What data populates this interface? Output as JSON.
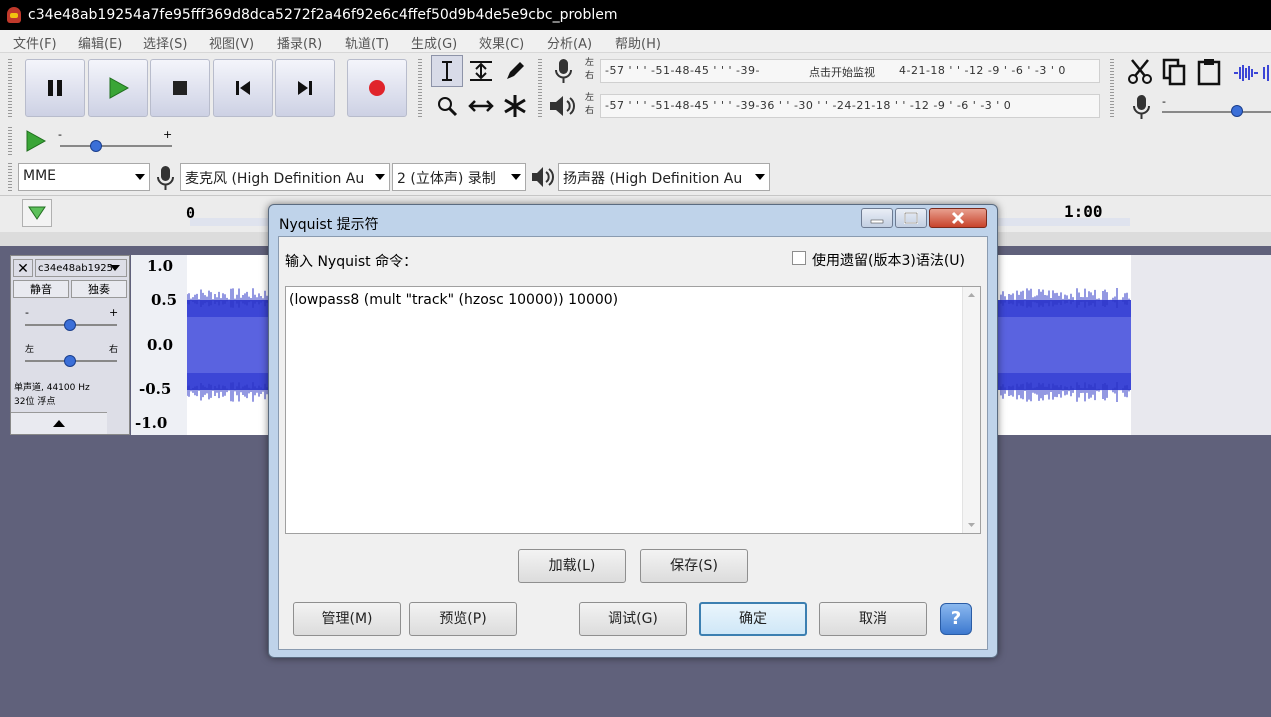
{
  "window": {
    "title": "c34e48ab19254a7fe95fff369d8dca5272f2a46f92e6c4ffef50d9b4de5e9cbc_problem"
  },
  "menu": [
    "文件(F)",
    "编辑(E)",
    "选择(S)",
    "视图(V)",
    "播录(R)",
    "轨道(T)",
    "生成(G)",
    "效果(C)",
    "分析(A)",
    "帮助(H)"
  ],
  "meters": {
    "record_left": "左",
    "record_right": "右",
    "record_ticks": "-57 ' ' ' -51-48-45 ' ' ' -39-",
    "record_prompt": "点击开始监视",
    "record_ticks2": "4-21-18 ' ' -12 -9 ' -6 ' -3 ' 0",
    "play_left": "左",
    "play_right": "右",
    "play_ticks": "-57 ' ' ' -51-48-45 ' ' ' -39-36 ' ' -30 ' ' -24-21-18 ' ' -12 -9 ' -6 ' -3 ' 0"
  },
  "device": {
    "host": "MME",
    "mic": "麦克风 (High Definition Au",
    "channels": "2 (立体声) 录制",
    "speaker": "扬声器 (High Definition Au"
  },
  "timeline": {
    "start": "0",
    "end": "1:00"
  },
  "slider_signs": {
    "minus": "-",
    "plus": "+"
  },
  "track": {
    "name": "c34e48ab1925",
    "mute": "静音",
    "solo": "独奏",
    "gain_minus": "-",
    "gain_plus": "+",
    "pan_left": "左",
    "pan_right": "右",
    "info1": "单声道, 44100 Hz",
    "info2": "32位 浮点",
    "scale": [
      "1.0",
      "0.5",
      "0.0",
      "-0.5",
      "-1.0"
    ]
  },
  "dialog": {
    "title": "Nyquist 提示符",
    "prompt_label": "输入 Nyquist 命令：",
    "legacy_label": "使用遗留(版本3)语法(U)",
    "legacy_checked": false,
    "command": "(lowpass8 (mult \"track\" (hzosc 10000)) 10000)",
    "load_label": "加载(L)",
    "save_label": "保存(S)",
    "manage_label": "管理(M)",
    "preview_label": "预览(P)",
    "debug_label": "调试(G)",
    "ok_label": "确定",
    "cancel_label": "取消",
    "help_label": "?"
  },
  "colors": {
    "wave": "#3c46d6",
    "wave_dark": "#1f28b8",
    "play": "#3aa537",
    "record": "#e0242b",
    "dialog_frame": "#bfd3ea",
    "help": "#4a8bdb"
  }
}
